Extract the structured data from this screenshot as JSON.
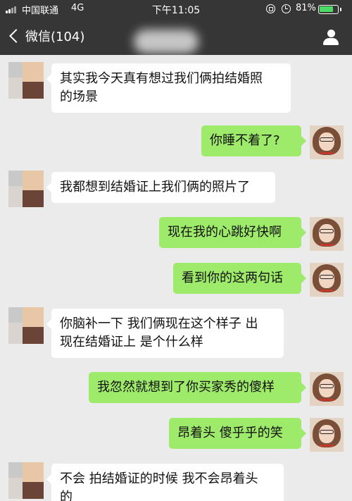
{
  "status_bar": {
    "carrier": "中国联通",
    "network": "4G",
    "time": "下午11:05",
    "battery_percent": "81%",
    "battery_level": 0.81
  },
  "nav": {
    "back_label": "微信(104)",
    "icons": [
      "chevron-left-icon",
      "person-icon"
    ]
  },
  "messages": [
    {
      "side": "left",
      "lines": [
        "其实我今天真有想过我们俩拍结婚照",
        "的场景"
      ]
    },
    {
      "side": "right",
      "lines": [
        "你睡不着了?"
      ]
    },
    {
      "side": "left",
      "lines": [
        "我都想到结婚证上我们俩的照片了"
      ]
    },
    {
      "side": "right",
      "lines": [
        "现在我的心跳好快啊"
      ]
    },
    {
      "side": "right",
      "lines": [
        "看到你的这两句话"
      ]
    },
    {
      "side": "left",
      "lines": [
        "你脑补一下 我们俩现在这个样子 出",
        "现在结婚证上 是个什么样"
      ]
    },
    {
      "side": "right",
      "lines": [
        "我忽然就想到了你买家秀的傻样"
      ]
    },
    {
      "side": "right",
      "lines": [
        "昂着头 傻乎乎的笑"
      ]
    },
    {
      "side": "left",
      "lines": [
        "不会 拍结婚证的时候 我不会昂着头",
        "的"
      ]
    }
  ],
  "colors": {
    "header_bg": "#363636",
    "chat_bg": "#ebebeb",
    "own_bubble": "#9eea6a",
    "other_bubble": "#ffffff",
    "battery_fill": "#4cd964"
  }
}
